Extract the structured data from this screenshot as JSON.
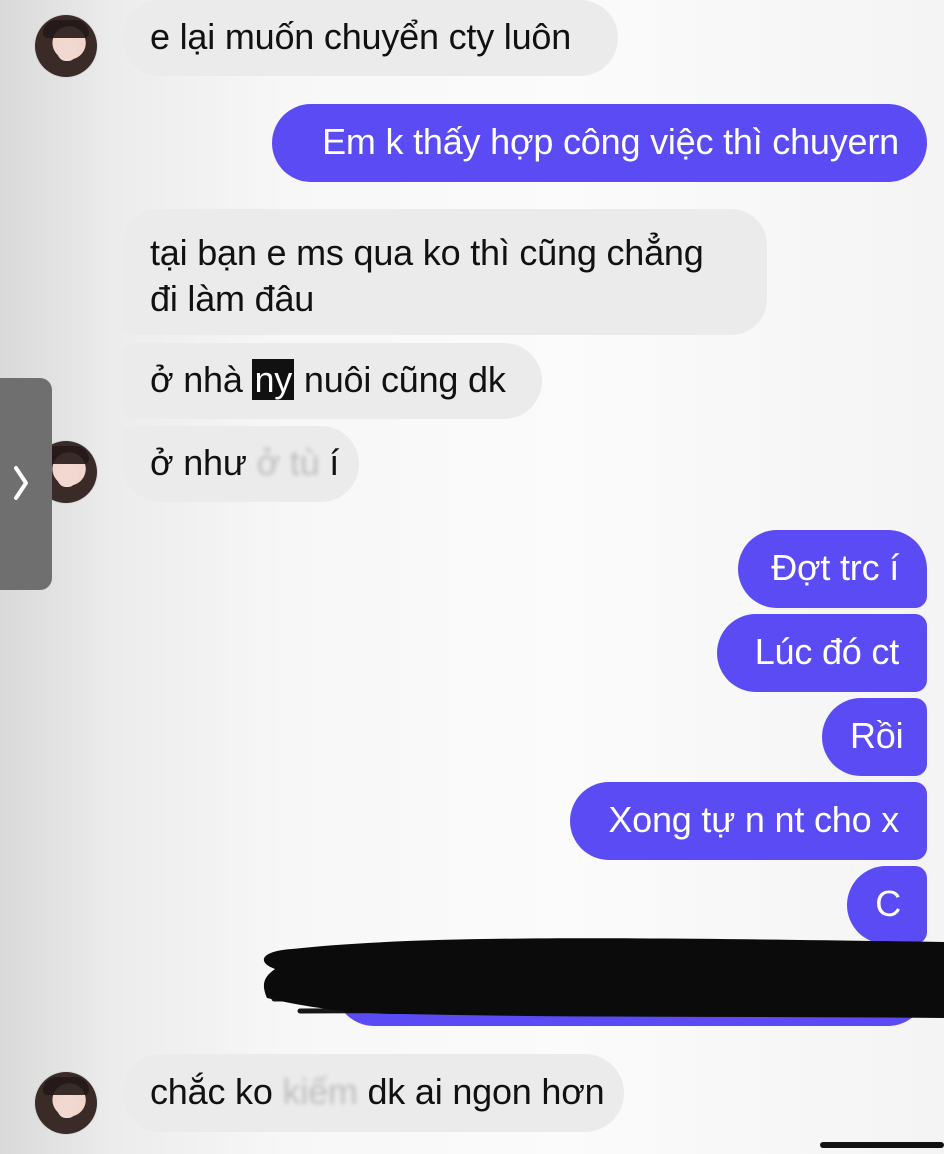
{
  "messages": [
    {
      "text": "e lại muốn chuyển cty luôn"
    },
    {
      "text": "Em k thấy hợp công việc thì chuyern"
    },
    {
      "line1": "tại bạn e ms qua ko thì cũng chẳng",
      "line2": "đi làm đâu"
    },
    {
      "before": "ở nhà ",
      "highlight": "ny",
      "after": " nuôi cũng dk"
    },
    {
      "before": "ở như ",
      "blurred": "ở tù",
      "after": " í"
    },
    {
      "text": "Đợt trc í"
    },
    {
      "text": "Lúc đó ct"
    },
    {
      "text": "Rồi"
    },
    {
      "text": "Xong tự n nt cho x"
    },
    {
      "text": "C"
    },
    {
      "before": "chắc ko ",
      "blurred": "kiếm",
      "after": " dk ai ngon hơn"
    }
  ],
  "colors": {
    "outgoing": "#5b4bf4",
    "incoming": "#ebebeb",
    "redaction": "#0b0b0b"
  },
  "icons": {
    "sidebar_toggle": "chevron-right-icon",
    "avatar": "avatar"
  }
}
